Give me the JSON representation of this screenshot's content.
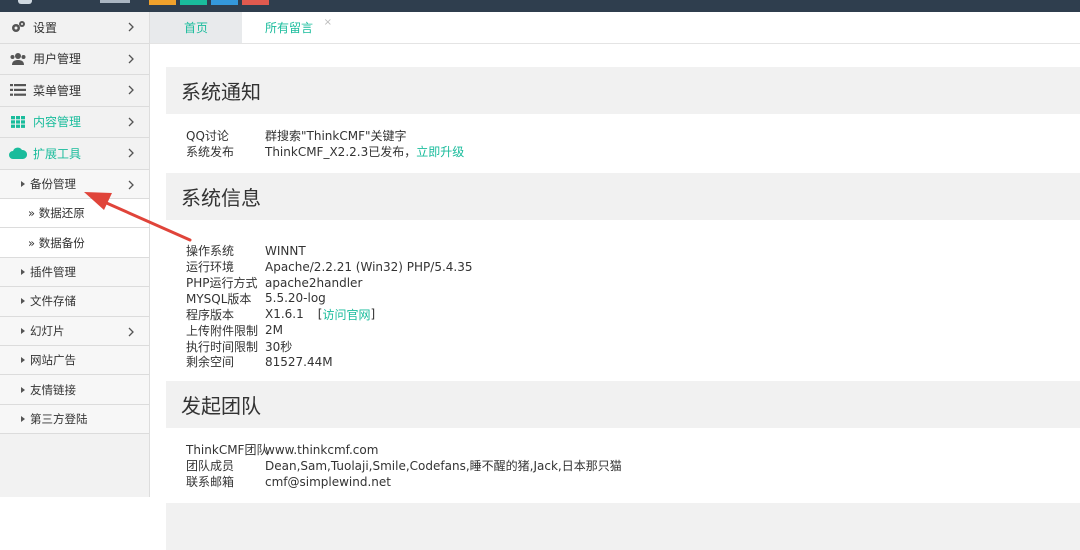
{
  "sidebar": {
    "menu": [
      {
        "label": "设置",
        "icon": "gears-icon"
      },
      {
        "label": "用户管理",
        "icon": "users-icon"
      },
      {
        "label": "菜单管理",
        "icon": "list-icon"
      },
      {
        "label": "内容管理",
        "icon": "grid-icon"
      },
      {
        "label": "扩展工具",
        "icon": "cloud-icon"
      }
    ],
    "backup": {
      "label": "备份管理"
    },
    "backup_children": [
      "» 数据还原",
      "» 数据备份"
    ],
    "tools": [
      {
        "label": "插件管理",
        "has_chevron": false
      },
      {
        "label": "文件存储",
        "has_chevron": false
      },
      {
        "label": "幻灯片",
        "has_chevron": true
      },
      {
        "label": "网站广告",
        "has_chevron": false
      },
      {
        "label": "友情链接",
        "has_chevron": false
      },
      {
        "label": "第三方登陆",
        "has_chevron": false
      }
    ]
  },
  "tabs": {
    "home": "首页",
    "messages": "所有留言",
    "close": "×"
  },
  "notice": {
    "title": "系统通知",
    "rows": [
      {
        "k": "QQ讨论",
        "v": "群搜索\"ThinkCMF\"关键字"
      },
      {
        "k": "系统发布",
        "v": "ThinkCMF_X2.2.3已发布，",
        "link": "立即升级"
      }
    ]
  },
  "sysinfo": {
    "title": "系统信息",
    "rows": [
      {
        "k": "操作系统",
        "v": "WINNT"
      },
      {
        "k": "运行环境",
        "v": "Apache/2.2.21 (Win32) PHP/5.4.35"
      },
      {
        "k": "PHP运行方式",
        "v": "apache2handler"
      },
      {
        "k": "MYSQL版本",
        "v": "5.5.20-log"
      },
      {
        "k": "程序版本",
        "v": "X1.6.1",
        "link_pre": "[",
        "link": "访问官网",
        "link_post": "]"
      },
      {
        "k": "上传附件限制",
        "v": "2M"
      },
      {
        "k": "执行时间限制",
        "v": "30秒"
      },
      {
        "k": "剩余空间",
        "v": "81527.44M"
      }
    ]
  },
  "team": {
    "title": "发起团队",
    "rows": [
      {
        "k": "ThinkCMF团队",
        "v": "www.thinkcmf.com"
      },
      {
        "k": "团队成员",
        "v": "Dean,Sam,Tuolaji,Smile,Codefans,睡不醒的猪,Jack,日本那只猫"
      },
      {
        "k": "联系邮箱",
        "v": "cmf@simplewind.net"
      }
    ]
  },
  "colors": {
    "accent": "#1abc9c",
    "topbar": "#2f3e4e",
    "arrow": "#e0443a",
    "swatches": [
      "#f0a12c",
      "#1abc9c",
      "#3498db",
      "#e05a4f"
    ]
  }
}
